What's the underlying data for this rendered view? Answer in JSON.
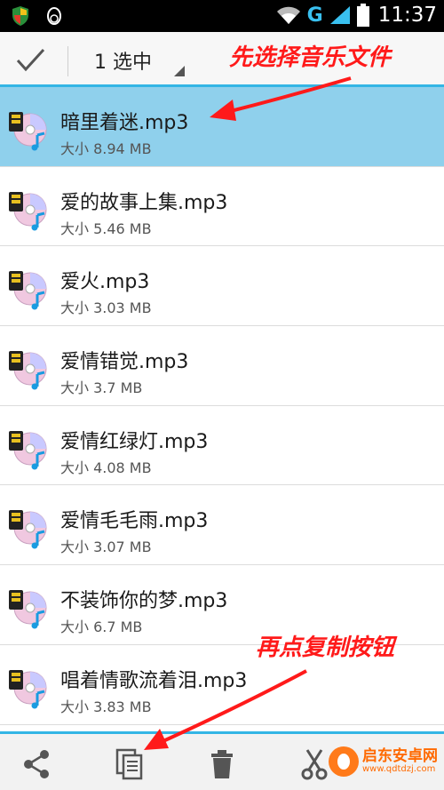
{
  "status_bar": {
    "network": "G",
    "time": "11:37",
    "left_icons": [
      "shield-icon",
      "qq-penguin-icon"
    ],
    "right_icons": [
      "wifi-icon",
      "signal-icon",
      "battery-icon"
    ]
  },
  "action_bar": {
    "selection_count": "1 选中",
    "done_icon": "check-icon",
    "accent": "#33b5e5"
  },
  "files": [
    {
      "name": "暗里着迷.mp3",
      "size": "大小 8.94 MB",
      "selected": true
    },
    {
      "name": "爱的故事上集.mp3",
      "size": "大小 5.46 MB",
      "selected": false
    },
    {
      "name": "爱火.mp3",
      "size": "大小 3.03 MB",
      "selected": false
    },
    {
      "name": "爱情错觉.mp3",
      "size": "大小 3.7 MB",
      "selected": false
    },
    {
      "name": "爱情红绿灯.mp3",
      "size": "大小 4.08 MB",
      "selected": false
    },
    {
      "name": "爱情毛毛雨.mp3",
      "size": "大小 3.07 MB",
      "selected": false
    },
    {
      "name": "不装饰你的梦.mp3",
      "size": "大小 6.7 MB",
      "selected": false
    },
    {
      "name": "唱着情歌流着泪.mp3",
      "size": "大小 3.83 MB",
      "selected": false
    }
  ],
  "file_icon": "music-disc-icon",
  "bottom_bar": {
    "buttons": [
      "share-icon",
      "copy-icon",
      "delete-icon",
      "cut-icon"
    ]
  },
  "annotations": {
    "top": "先选择音乐文件",
    "bottom": "再点复制按钮",
    "color": "#ff1a1a"
  },
  "watermark": {
    "text": "启东安卓网",
    "url": "www.qdtdzj.com"
  },
  "colors": {
    "selected_row": "#8fd0ec",
    "accent": "#33b5e5"
  }
}
